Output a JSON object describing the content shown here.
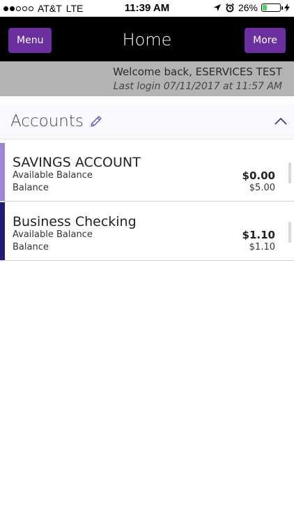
{
  "status_bar": {
    "carrier": "AT&T",
    "network": "LTE",
    "time": "11:39 AM",
    "battery_percent_text": "26%",
    "battery_level": 0.26,
    "signal_bars_filled": 2,
    "signal_bars_total": 5
  },
  "nav": {
    "menu_label": "Menu",
    "title": "Home",
    "more_label": "More",
    "button_color": "#6b2fa0"
  },
  "welcome": {
    "greeting": "Welcome back, ESERVICES TEST",
    "last_login": "Last login 07/11/2017 at 11:57 AM"
  },
  "accounts_section": {
    "title": "Accounts",
    "edit_icon": "pencil-icon",
    "collapse_icon": "chevron-up-icon"
  },
  "accounts": [
    {
      "name": "SAVINGS ACCOUNT",
      "available_label": "Available Balance",
      "available_value": "$0.00",
      "balance_label": "Balance",
      "balance_value": "$5.00",
      "stripe_color": "#9c86d9"
    },
    {
      "name": "Business Checking",
      "available_label": "Available Balance",
      "available_value": "$1.10",
      "balance_label": "Balance",
      "balance_value": "$1.10",
      "stripe_color": "#1f1c7a"
    }
  ]
}
